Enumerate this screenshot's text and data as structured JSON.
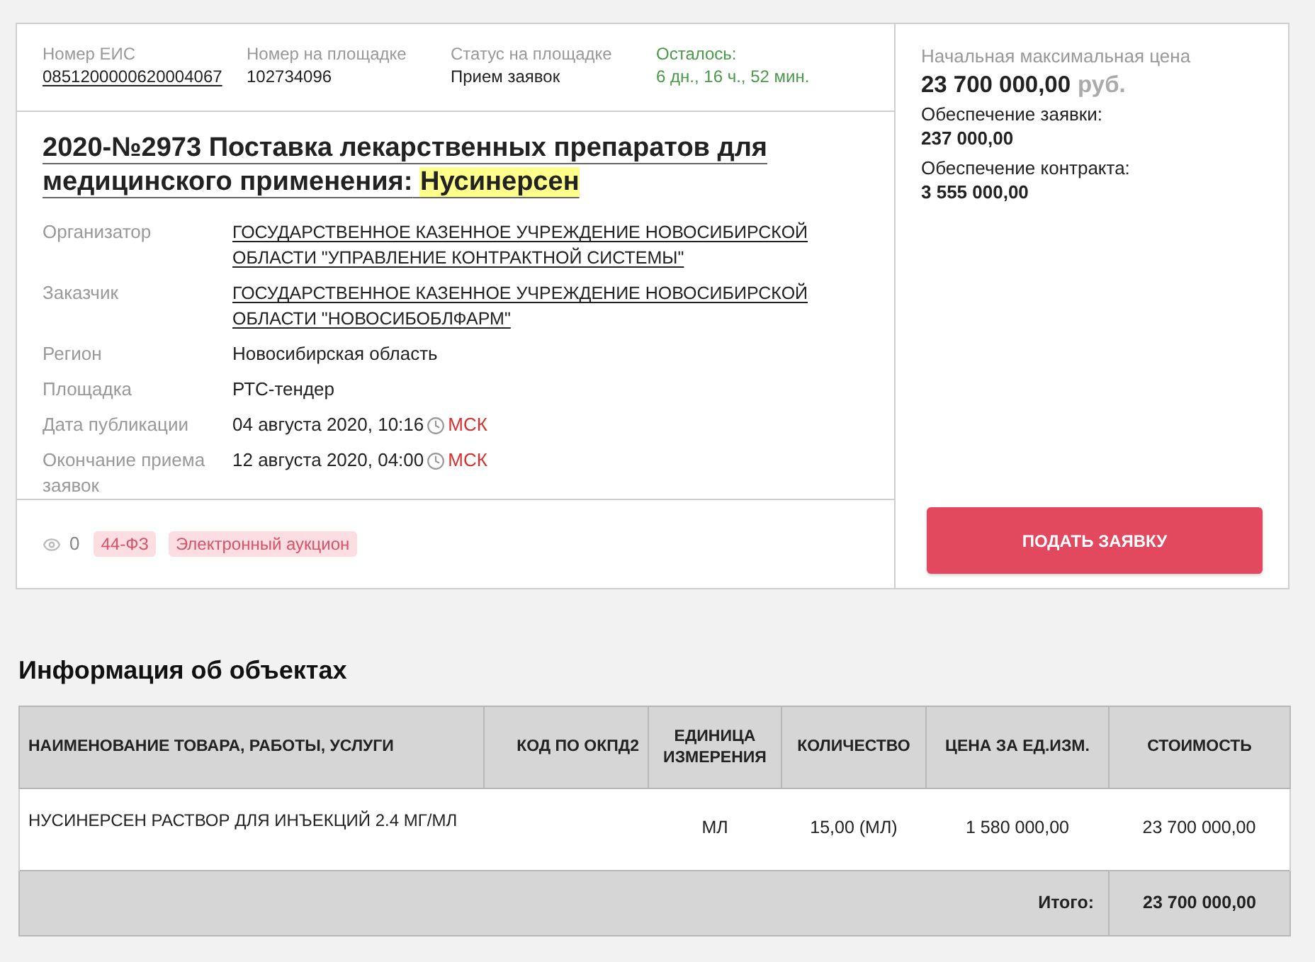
{
  "header_fields": [
    {
      "label": "Номер ЕИС",
      "value": "0851200000620004067",
      "kind": "link"
    },
    {
      "label": "Номер на площадке",
      "value": "102734096",
      "kind": "text"
    },
    {
      "label": "Статус на площадке",
      "value": "Прием заявок",
      "kind": "text"
    },
    {
      "label": "Осталось:",
      "value": "6 дн., 16 ч., 52 мин.",
      "kind": "countdown"
    }
  ],
  "title": [
    {
      "text": "2020-№2973 Поставка лекарственных препаратов для медицинского применения:",
      "highlighted": false
    },
    {
      "text": "Нусинерсен",
      "highlighted": true
    }
  ],
  "details": [
    {
      "label": "Организатор",
      "value": "ГОСУДАРСТВЕННОЕ КАЗЕННОЕ УЧРЕЖДЕНИЕ НОВОСИБИРСКОЙ ОБЛАСТИ \"УПРАВЛЕНИЕ КОНТРАКТНОЙ СИСТЕМЫ\"",
      "kind": "link"
    },
    {
      "label": "Заказчик",
      "value": "ГОСУДАРСТВЕННОЕ КАЗЕННОЕ УЧРЕЖДЕНИЕ НОВОСИБИРСКОЙ ОБЛАСТИ \"НОВОСИБОБЛФАРМ\"",
      "kind": "link"
    },
    {
      "label": "Регион",
      "value": "Новосибирская область",
      "kind": "text"
    },
    {
      "label": "Площадка",
      "value": "РТС-тендер",
      "kind": "text"
    },
    {
      "label": "Дата публикации",
      "value": "04 августа 2020, 10:16",
      "kind": "datetime",
      "timezone": "МСК"
    },
    {
      "label": "Окончание приема заявок",
      "value": "12 августа 2020, 04:00",
      "kind": "datetime",
      "timezone": "МСК"
    }
  ],
  "views": "0",
  "tags": [
    "44-ФЗ",
    "Электронный аукцион"
  ],
  "price": {
    "label": "Начальная максимальная цена",
    "amount": "23 700 000,00",
    "currency": "руб."
  },
  "securities": [
    {
      "label": "Обеспечение заявки:",
      "value": "237 000,00"
    },
    {
      "label": "Обеспечение контракта:",
      "value": "3 555 000,00"
    }
  ],
  "apply_button": "ПОДАТЬ ЗАЯВКУ",
  "objects": {
    "title": "Информация об объектах",
    "columns": [
      "НАИМЕНОВАНИЕ ТОВАРА, РАБОТЫ, УСЛУГИ",
      "КОД ПО ОКПД2",
      "ЕДИНИЦА ИЗМЕРЕНИЯ",
      "КОЛИЧЕСТВО",
      "ЦЕНА ЗА ЕД.ИЗМ.",
      "СТОИМОСТЬ"
    ],
    "rows": [
      {
        "name": "НУСИНЕРСЕН РАСТВОР ДЛЯ ИНЪЕКЦИЙ 2.4 МГ/МЛ",
        "unit": "МЛ",
        "quantity": "15,00 (МЛ)",
        "price": "1 580 000,00",
        "cost": "23 700 000,00"
      }
    ],
    "total": {
      "label": "Итого:",
      "value": "23 700 000,00"
    }
  }
}
